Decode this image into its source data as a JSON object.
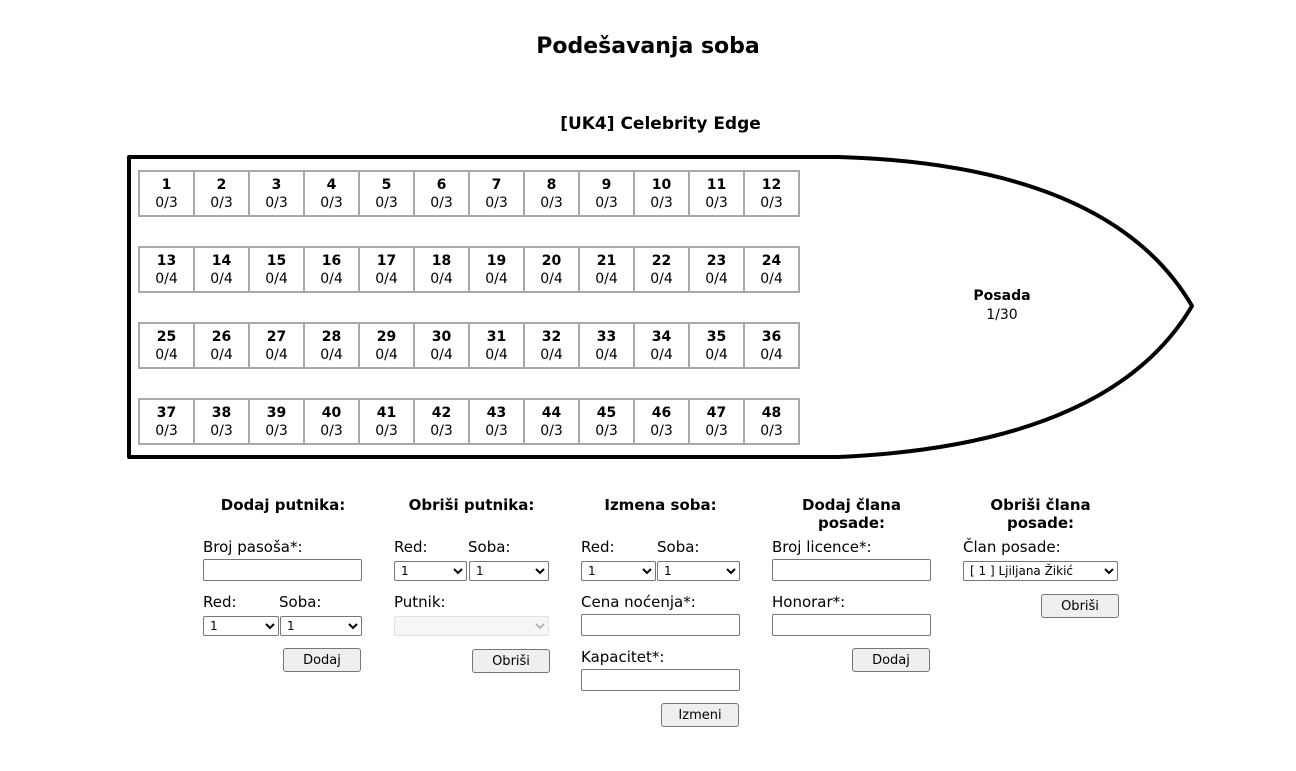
{
  "page_title": "Podešavanja soba",
  "ship_title": "[UK4] Celebrity Edge",
  "room_rows": [
    [
      {
        "num": "1",
        "occ": "0/3"
      },
      {
        "num": "2",
        "occ": "0/3"
      },
      {
        "num": "3",
        "occ": "0/3"
      },
      {
        "num": "4",
        "occ": "0/3"
      },
      {
        "num": "5",
        "occ": "0/3"
      },
      {
        "num": "6",
        "occ": "0/3"
      },
      {
        "num": "7",
        "occ": "0/3"
      },
      {
        "num": "8",
        "occ": "0/3"
      },
      {
        "num": "9",
        "occ": "0/3"
      },
      {
        "num": "10",
        "occ": "0/3"
      },
      {
        "num": "11",
        "occ": "0/3"
      },
      {
        "num": "12",
        "occ": "0/3"
      }
    ],
    [
      {
        "num": "13",
        "occ": "0/4"
      },
      {
        "num": "14",
        "occ": "0/4"
      },
      {
        "num": "15",
        "occ": "0/4"
      },
      {
        "num": "16",
        "occ": "0/4"
      },
      {
        "num": "17",
        "occ": "0/4"
      },
      {
        "num": "18",
        "occ": "0/4"
      },
      {
        "num": "19",
        "occ": "0/4"
      },
      {
        "num": "20",
        "occ": "0/4"
      },
      {
        "num": "21",
        "occ": "0/4"
      },
      {
        "num": "22",
        "occ": "0/4"
      },
      {
        "num": "23",
        "occ": "0/4"
      },
      {
        "num": "24",
        "occ": "0/4"
      }
    ],
    [
      {
        "num": "25",
        "occ": "0/4"
      },
      {
        "num": "26",
        "occ": "0/4"
      },
      {
        "num": "27",
        "occ": "0/4"
      },
      {
        "num": "28",
        "occ": "0/4"
      },
      {
        "num": "29",
        "occ": "0/4"
      },
      {
        "num": "30",
        "occ": "0/4"
      },
      {
        "num": "31",
        "occ": "0/4"
      },
      {
        "num": "32",
        "occ": "0/4"
      },
      {
        "num": "33",
        "occ": "0/4"
      },
      {
        "num": "34",
        "occ": "0/4"
      },
      {
        "num": "35",
        "occ": "0/4"
      },
      {
        "num": "36",
        "occ": "0/4"
      }
    ],
    [
      {
        "num": "37",
        "occ": "0/3"
      },
      {
        "num": "38",
        "occ": "0/3"
      },
      {
        "num": "39",
        "occ": "0/3"
      },
      {
        "num": "40",
        "occ": "0/3"
      },
      {
        "num": "41",
        "occ": "0/3"
      },
      {
        "num": "42",
        "occ": "0/3"
      },
      {
        "num": "43",
        "occ": "0/3"
      },
      {
        "num": "44",
        "occ": "0/3"
      },
      {
        "num": "45",
        "occ": "0/3"
      },
      {
        "num": "46",
        "occ": "0/3"
      },
      {
        "num": "47",
        "occ": "0/3"
      },
      {
        "num": "48",
        "occ": "0/3"
      }
    ]
  ],
  "crew": {
    "label": "Posada",
    "value": "1/30"
  },
  "add_passenger": {
    "title": "Dodaj putnika:",
    "passport_label": "Broj pasoša*:",
    "passport_value": "",
    "row_label": "Red:",
    "row_value": "1",
    "room_label": "Soba:",
    "room_value": "1",
    "button": "Dodaj"
  },
  "delete_passenger": {
    "title": "Obriši putnika:",
    "row_label": "Red:",
    "row_value": "1",
    "room_label": "Soba:",
    "room_value": "1",
    "passenger_label": "Putnik:",
    "passenger_value": "",
    "button": "Obriši"
  },
  "edit_room": {
    "title": "Izmena soba:",
    "row_label": "Red:",
    "row_value": "1",
    "room_label": "Soba:",
    "room_value": "1",
    "price_label": "Cena noćenja*:",
    "price_value": "",
    "capacity_label": "Kapacitet*:",
    "capacity_value": "",
    "button": "Izmeni"
  },
  "add_crew": {
    "title": "Dodaj člana posade:",
    "license_label": "Broj licence*:",
    "license_value": "",
    "fee_label": "Honorar*:",
    "fee_value": "",
    "button": "Dodaj"
  },
  "delete_crew": {
    "title": "Obriši člana posade:",
    "member_label": "Član posade:",
    "member_value": "[ 1 ] Ljiljana Žikić",
    "button": "Obriši"
  }
}
